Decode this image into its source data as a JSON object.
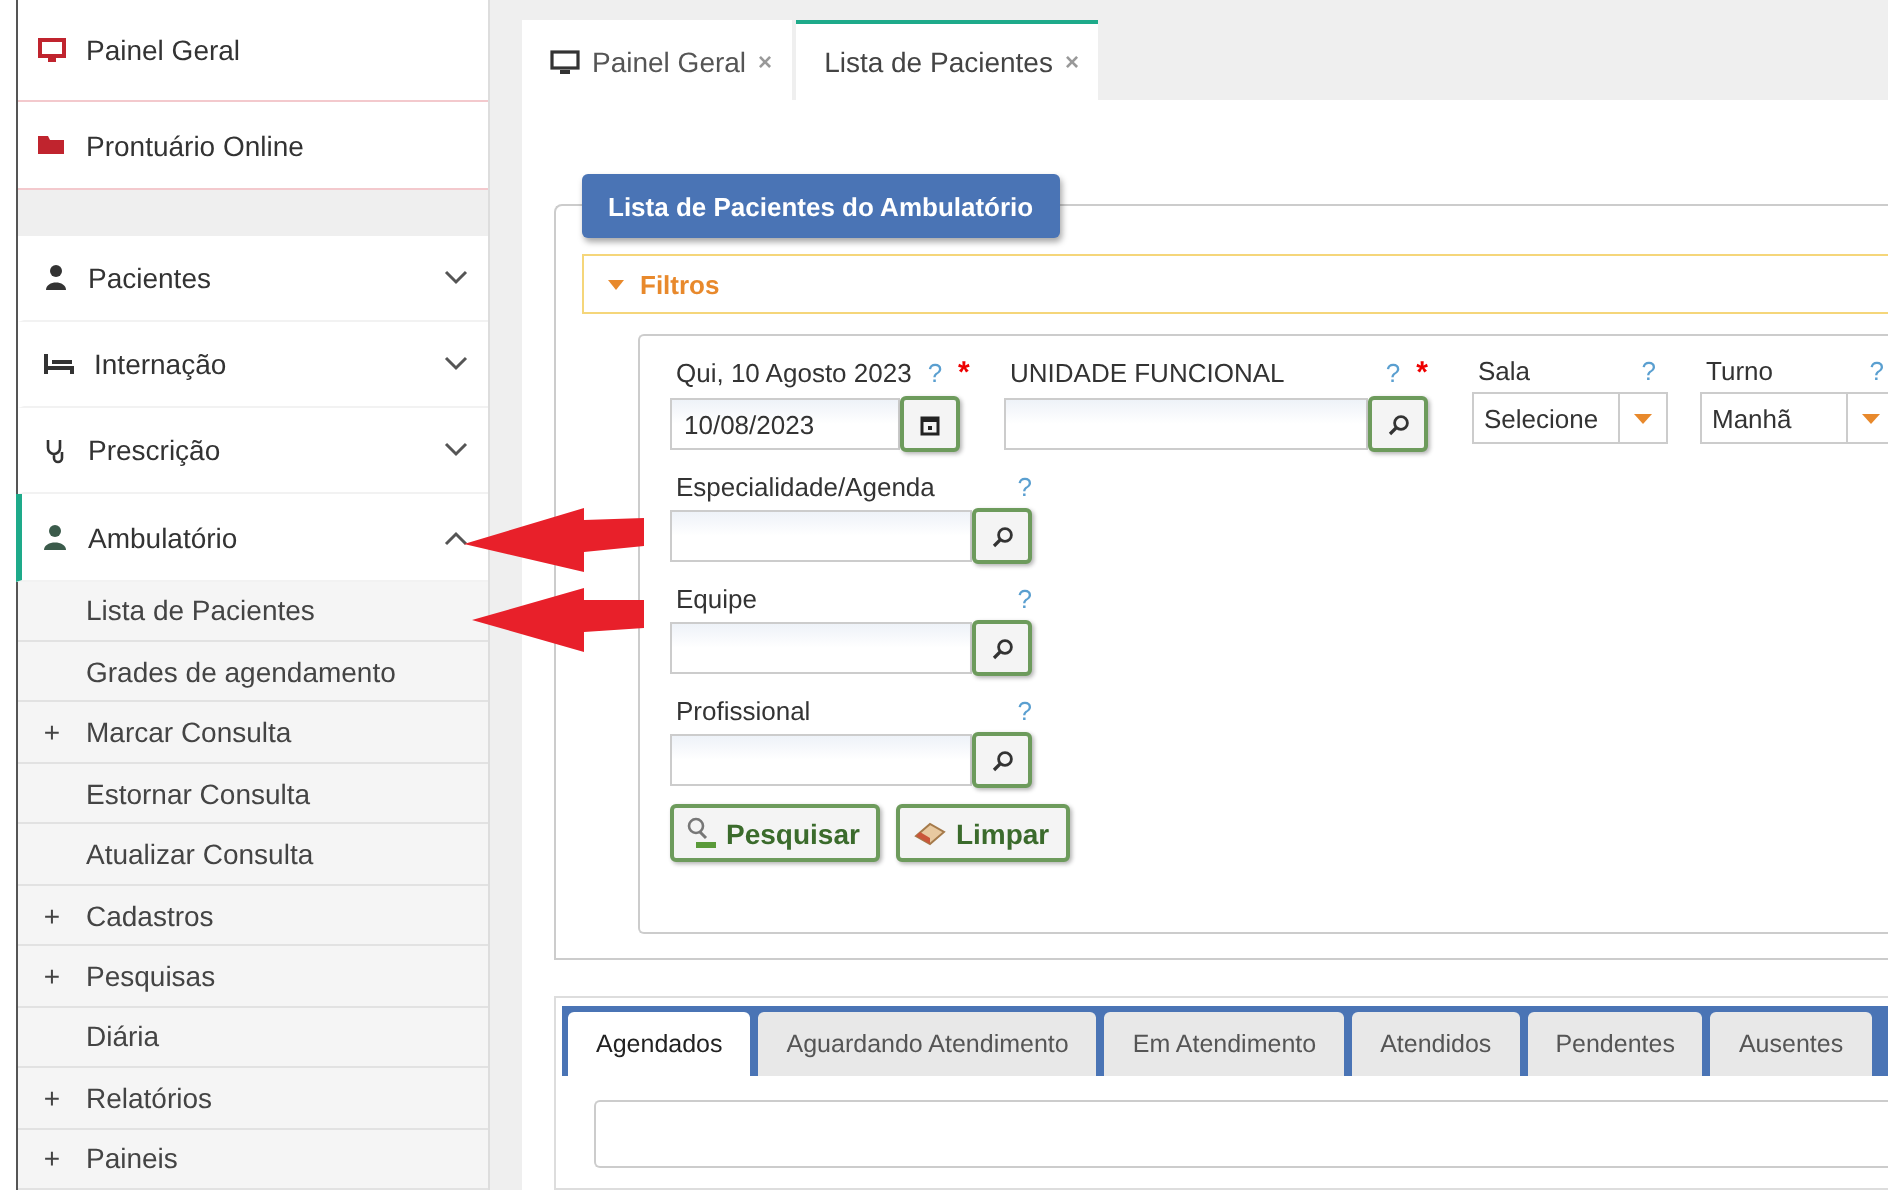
{
  "sidebar": {
    "top_items": [
      {
        "label": "Painel Geral",
        "kind": "monitor"
      },
      {
        "label": "Prontuário Online",
        "kind": "folder"
      }
    ],
    "menu": [
      {
        "label": "Pacientes",
        "kind": "person",
        "expanded": false
      },
      {
        "label": "Internação",
        "kind": "bed",
        "expanded": false
      },
      {
        "label": "Prescrição",
        "kind": "stethoscope",
        "expanded": false
      },
      {
        "label": "Ambulatório",
        "kind": "doctor",
        "expanded": true,
        "children": [
          {
            "label": "Lista de Pacientes",
            "kind": "link"
          },
          {
            "label": "Grades de agendamento",
            "kind": "link"
          },
          {
            "label": "Marcar Consulta",
            "kind": "group",
            "plus": "+"
          },
          {
            "label": "Estornar Consulta",
            "kind": "link"
          },
          {
            "label": "Atualizar Consulta",
            "kind": "link"
          },
          {
            "label": "Cadastros",
            "kind": "group",
            "plus": "+"
          },
          {
            "label": "Pesquisas",
            "kind": "group",
            "plus": "+"
          },
          {
            "label": "Diária",
            "kind": "link"
          },
          {
            "label": "Relatórios",
            "kind": "group",
            "plus": "+"
          },
          {
            "label": "Paineis",
            "kind": "group",
            "plus": "+"
          }
        ]
      }
    ]
  },
  "tabs": [
    {
      "label": "Painel Geral",
      "selected": false,
      "kind": "monitor",
      "close": "×"
    },
    {
      "label": "Lista de Pacientes",
      "selected": true,
      "kind": "plain",
      "close": "×"
    }
  ],
  "panel": {
    "title": "Lista de Pacientes do Ambulatório",
    "filters_title": "Filtros",
    "expanded": true,
    "field_rows": [
      [
        {
          "label": "Qui, 10 Agosto 2023",
          "help": "?",
          "required_mark": "*",
          "kind": "date",
          "value": "10/08/2023"
        },
        {
          "label": "UNIDADE FUNCIONAL",
          "help": "?",
          "required_mark": "*",
          "kind": "lookup"
        },
        {
          "label": "Sala",
          "help": "?",
          "kind": "select",
          "value": "Selecione"
        },
        {
          "label": "Turno",
          "help": "?",
          "kind": "select",
          "value": "Manhã"
        }
      ],
      [
        {
          "label": "Especialidade/Agenda",
          "help": "?",
          "kind": "lookup"
        }
      ],
      [
        {
          "label": "Equipe",
          "help": "?",
          "kind": "lookup"
        }
      ],
      [
        {
          "label": "Profissional",
          "help": "?",
          "kind": "lookup"
        }
      ]
    ],
    "buttons": [
      {
        "label": "Pesquisar",
        "kind": "search"
      },
      {
        "label": "Limpar",
        "kind": "eraser"
      }
    ],
    "result_tabs": [
      {
        "label": "Agendados",
        "selected": true
      },
      {
        "label": "Aguardando Atendimento",
        "selected": false
      },
      {
        "label": "Em Atendimento",
        "selected": false
      },
      {
        "label": "Atendidos",
        "selected": false
      },
      {
        "label": "Pendentes",
        "selected": false
      },
      {
        "label": "Ausentes",
        "selected": false
      }
    ]
  }
}
